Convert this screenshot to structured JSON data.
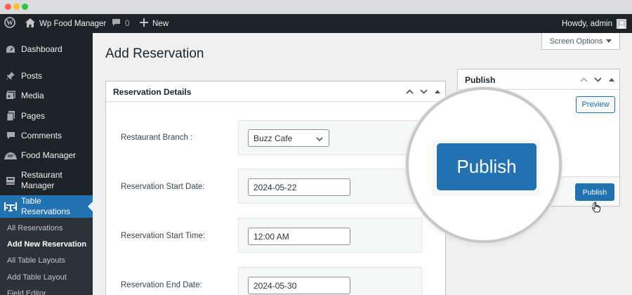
{
  "admin_bar": {
    "site_name": "Wp Food Manager",
    "comments_count": "0",
    "new_label": "New",
    "howdy": "Howdy, admin"
  },
  "sidebar": {
    "items": [
      {
        "label": "Dashboard",
        "icon": "dashboard-icon"
      },
      {
        "label": "Posts",
        "icon": "pin-icon"
      },
      {
        "label": "Media",
        "icon": "media-icon"
      },
      {
        "label": "Pages",
        "icon": "pages-icon"
      },
      {
        "label": "Comments",
        "icon": "comment-icon"
      },
      {
        "label": "Food Manager",
        "icon": "food-manager-icon"
      },
      {
        "label": "Restaurant Manager",
        "icon": "restaurant-icon"
      },
      {
        "label": "Table Reservations",
        "icon": "table-icon",
        "current": true
      }
    ],
    "submenu": [
      {
        "label": "All Reservations"
      },
      {
        "label": "Add New Reservation",
        "active": true
      },
      {
        "label": "All Table Layouts"
      },
      {
        "label": "Add Table Layout"
      },
      {
        "label": "Field Editor"
      }
    ]
  },
  "page": {
    "title": "Add Reservation",
    "screen_options": "Screen Options"
  },
  "reservation_details": {
    "title": "Reservation Details",
    "fields": [
      {
        "label": "Restaurant Branch :",
        "value": "Buzz Cafe",
        "type": "select"
      },
      {
        "label": "Reservation Start Date:",
        "value": "2024-05-22",
        "type": "input"
      },
      {
        "label": "Reservation Start Time:",
        "value": "12:00 AM",
        "type": "input"
      },
      {
        "label": "Reservation End Date:",
        "value": "2024-05-30",
        "type": "input"
      }
    ]
  },
  "publish": {
    "title": "Publish",
    "preview_label": "Preview",
    "publish_label": "Publish",
    "zoom_label": "Publish"
  },
  "colors": {
    "accent": "#2271b1",
    "admin_bar": "#1d2327",
    "background": "#f0f0f1"
  }
}
